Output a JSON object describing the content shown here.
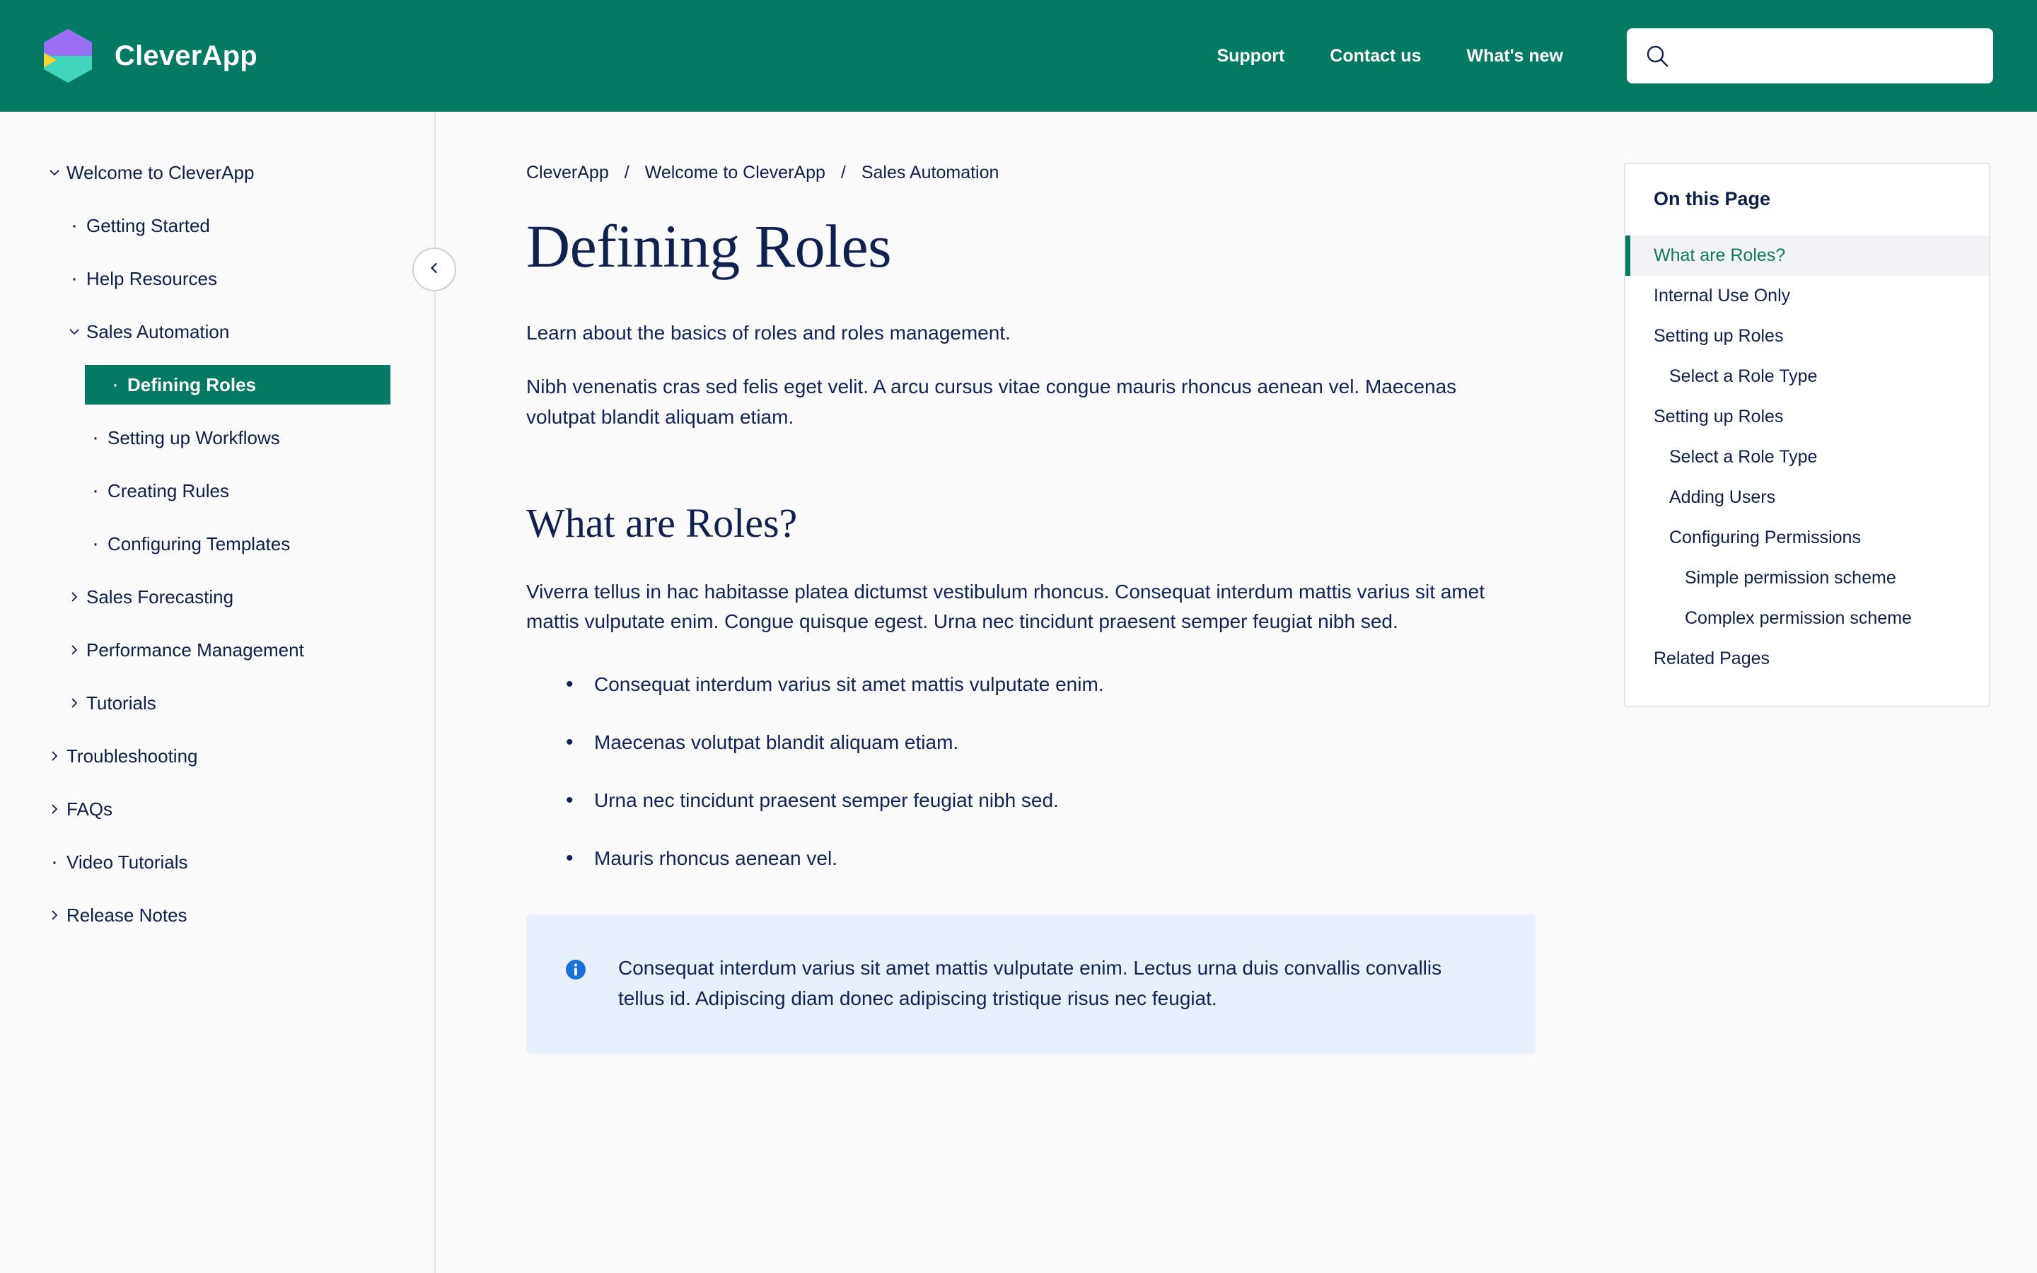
{
  "header": {
    "brand_name": "CleverApp",
    "logo_icon": "hexagon-logo-icon",
    "nav_links": [
      {
        "label": "Support"
      },
      {
        "label": "Contact us"
      },
      {
        "label": "What's new"
      }
    ],
    "search": {
      "icon": "search-icon",
      "value": "",
      "placeholder": ""
    },
    "colors": {
      "background": "#047a63",
      "text": "#ffffff"
    }
  },
  "sidebar": {
    "collapse_button_icon": "chevron-left-icon",
    "items": [
      {
        "label": "Welcome to CleverApp",
        "level": 0,
        "marker": "chevron-down-icon",
        "active": false
      },
      {
        "label": "Getting Started",
        "level": 1,
        "marker": "bullet-dot-icon",
        "active": false
      },
      {
        "label": "Help Resources",
        "level": 1,
        "marker": "bullet-dot-icon",
        "active": false
      },
      {
        "label": "Sales Automation",
        "level": 1,
        "marker": "chevron-down-icon",
        "active": false
      },
      {
        "label": "Defining Roles",
        "level": 2,
        "marker": "bullet-dot-icon",
        "active": true
      },
      {
        "label": "Setting up Workflows",
        "level": 2,
        "marker": "bullet-dot-icon",
        "active": false
      },
      {
        "label": "Creating Rules",
        "level": 2,
        "marker": "bullet-dot-icon",
        "active": false
      },
      {
        "label": "Configuring Templates",
        "level": 2,
        "marker": "bullet-dot-icon",
        "active": false
      },
      {
        "label": "Sales Forecasting",
        "level": 1,
        "marker": "chevron-right-icon",
        "active": false
      },
      {
        "label": "Performance Management",
        "level": 1,
        "marker": "chevron-right-icon",
        "active": false
      },
      {
        "label": "Tutorials",
        "level": 1,
        "marker": "chevron-right-icon",
        "active": false
      },
      {
        "label": "Troubleshooting",
        "level": 0,
        "marker": "chevron-right-icon",
        "active": false
      },
      {
        "label": "FAQs",
        "level": 0,
        "marker": "chevron-right-icon",
        "active": false
      },
      {
        "label": "Video Tutorials",
        "level": 0,
        "marker": "bullet-dot-icon",
        "active": false
      },
      {
        "label": "Release Notes",
        "level": 0,
        "marker": "chevron-right-icon",
        "active": false
      }
    ]
  },
  "breadcrumb": {
    "separator": "/",
    "items": [
      {
        "label": "CleverApp"
      },
      {
        "label": "Welcome to CleverApp"
      },
      {
        "label": "Sales Automation"
      }
    ]
  },
  "article": {
    "title": "Defining Roles",
    "intro": "Learn about the basics of roles and roles management.",
    "paragraph_1": "Nibh venenatis cras sed felis eget velit. A arcu cursus vitae congue mauris rhoncus aenean vel. Maecenas volutpat blandit aliquam etiam.",
    "section_heading": "What are Roles?",
    "paragraph_2": "Viverra tellus in hac habitasse platea dictumst vestibulum rhoncus. Consequat interdum mattis varius sit amet mattis vulputate enim. Congue quisque egest. Urna nec tincidunt praesent semper feugiat nibh sed.",
    "bullets": [
      "Consequat interdum varius sit amet mattis vulputate enim.",
      "Maecenas volutpat blandit aliquam etiam.",
      "Urna nec tincidunt praesent semper feugiat nibh sed.",
      "Mauris rhoncus aenean vel."
    ],
    "callout": {
      "icon": "info-circle-icon",
      "text": "Consequat interdum varius sit amet mattis vulputate enim. Lectus urna duis convallis convallis tellus id. Adipiscing diam donec adipiscing tristique risus nec feugiat.",
      "background": "#e9f0fd",
      "icon_color": "#1a6fe0"
    }
  },
  "toc": {
    "title": "On this Page",
    "active_color": "#0b7a5c",
    "items": [
      {
        "label": "What are Roles?",
        "depth": 0,
        "active": true
      },
      {
        "label": "Internal Use Only",
        "depth": 0,
        "active": false
      },
      {
        "label": "Setting up Roles",
        "depth": 0,
        "active": false
      },
      {
        "label": "Select a Role Type",
        "depth": 1,
        "active": false
      },
      {
        "label": "Setting up Roles",
        "depth": 0,
        "active": false
      },
      {
        "label": "Select a Role Type",
        "depth": 1,
        "active": false
      },
      {
        "label": "Adding Users",
        "depth": 1,
        "active": false
      },
      {
        "label": "Configuring Permissions",
        "depth": 1,
        "active": false
      },
      {
        "label": "Simple permission scheme",
        "depth": 2,
        "active": false
      },
      {
        "label": "Complex permission scheme",
        "depth": 2,
        "active": false
      },
      {
        "label": "Related Pages",
        "depth": 0,
        "active": false
      }
    ]
  }
}
